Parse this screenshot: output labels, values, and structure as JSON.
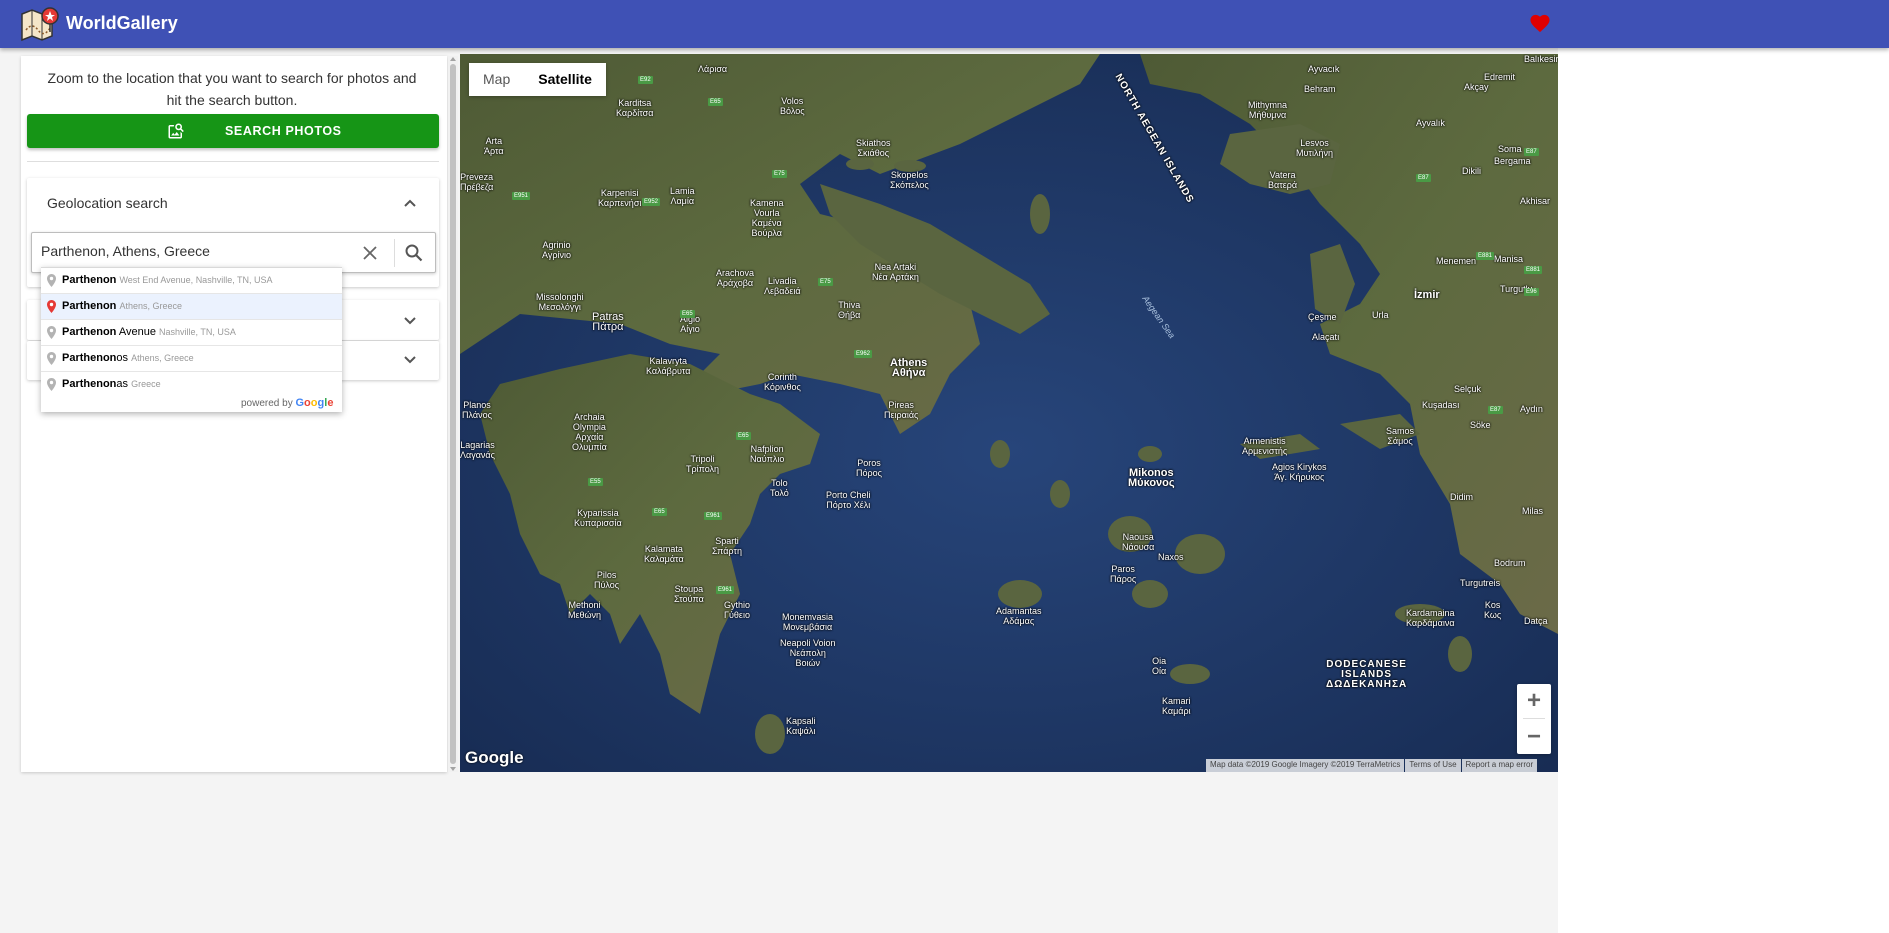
{
  "app": {
    "title": "WorldGallery",
    "logo_icon": "map-pin-logo-icon",
    "favorite_icon": "heart-icon",
    "accent_color": "#3f51b5",
    "favorite_color": "#e00000"
  },
  "panel": {
    "instructions": "Zoom to the location that you want to search for photos and hit the search button.",
    "search_button": {
      "label": "SEARCH PHOTOS",
      "icon": "image-search-icon",
      "color": "#169516"
    },
    "geolocation": {
      "title": "Geolocation search",
      "expanded": true,
      "input_value": "Parthenon, Athens, Greece",
      "clear_icon": "close-icon",
      "search_icon": "search-icon"
    },
    "collapsed_sections": [
      {
        "icon": "chevron-down-icon"
      },
      {
        "icon": "chevron-down-icon"
      }
    ]
  },
  "autocomplete": {
    "items": [
      {
        "match": "Parthenon",
        "rest": "",
        "secondary": "West End Avenue, Nashville, TN, USA",
        "selected": false
      },
      {
        "match": "Parthenon",
        "rest": "",
        "secondary": "Athens, Greece",
        "selected": true
      },
      {
        "match": "Parthenon",
        "rest": " Avenue",
        "secondary": "Nashville, TN, USA",
        "selected": false
      },
      {
        "match": "Parthenon",
        "rest": "os",
        "secondary": "Athens, Greece",
        "selected": false
      },
      {
        "match": "Parthenon",
        "rest": "as",
        "secondary": "Greece",
        "selected": false
      }
    ],
    "powered_by": "powered by",
    "powered_brand": "Google"
  },
  "map": {
    "map_type_options": [
      "Map",
      "Satellite"
    ],
    "active_map_type": "Satellite",
    "zoom_in": "+",
    "zoom_out": "−",
    "logo": "Google",
    "attribution": [
      "Map data ©2019 Google Imagery ©2019 TerraMetrics",
      "Terms of Use",
      "Report a map error"
    ],
    "labels": {
      "volos": "Volos\nΒόλος",
      "karditsa": "Karditsa\nΚαρδίτσα",
      "lamia": "Lamia\nΛαμία",
      "karpenisi": "Karpenisi\nΚαρπενήσι",
      "kamena_vourla": "Kamena\nVourla\nΚαμένα\nΒούρλα",
      "skiathos": "Skiathos\nΣκιάθος",
      "skopelos": "Skopelos\nΣκόπελος",
      "agrinio": "Agrinio\nΑγρίνιο",
      "missolonghi": "Missolonghi\nΜεσολόγγι",
      "arachova": "Arachova\nΑράχοβα",
      "livadia": "Livadia\nΛεβαδειά",
      "nea_artaki": "Nea Artaki\nΝέα Αρτάκη",
      "thiva": "Thiva\nΘήβα",
      "patras": "Patras\nΠάτρα",
      "aigio": "Aigio\nΑίγιο",
      "athens": "Athens\nΑθήνα",
      "pireas": "Pireas\nΠειραιάς",
      "corinth": "Corinth\nΚόρινθος",
      "kalavryta": "Kalavryta\nΚαλάβρυτα",
      "archaia_olympia": "Archaia\nOlympia\nΑρχαία\nΟλυμπία",
      "tripoli": "Tripoli\nΤρίπολη",
      "nafplion": "Nafplion\nΝαύπλιο",
      "poros": "Poros\nΠόρος",
      "tolo": "Tolo\nΤολό",
      "porto_cheli": "Porto Cheli\nΠόρτο Χέλι",
      "kyparissia": "Kyparissia\nΚυπαρισσία",
      "kalamata": "Kalamata\nΚαλαμάτα",
      "sparti": "Sparti\nΣπάρτη",
      "pilos": "Pilos\nΠύλος",
      "methoni": "Methoni\nΜεθώνη",
      "stoupa": "Stoupa\nΣτούπα",
      "gythio": "Gythio\nΓύθειο",
      "monemvasia": "Monemvasia\nΜονεμβάσια",
      "neapoli": "Neapoli Voion\nΝεάπολη\nΒοιών",
      "kapsali": "Kapsali\nΚαψάλι",
      "planos": "Planos\nΠλάνος",
      "lagarias": "Lagarias\nΛαγανάς",
      "mikonos": "Mikonos\nΜύκονος",
      "naousa": "Naousa\nΝάουσα",
      "naxos": "Naxos",
      "paros": "Paros\nΠάρος",
      "adamantas": "Adamantas\nΑδάμας",
      "oia": "Oia\nΟία",
      "kamari": "Kamari\nΚαμάρι",
      "armenistis": "Armenistis\nΑρμενιστής",
      "agios_kirykos": "Agios Kirykos\nΆγ. Κήρυκος",
      "samos": "Samos\nΣάμος",
      "lesvos": "Lesvos\nΜυτιλήνη",
      "mithymna": "Mithymna\nΜήθυμνα",
      "vatera": "Vatera\nΒατερά",
      "ayvacik": "Ayvacık",
      "behram": "Behram",
      "edremit": "Edremit",
      "akcay": "Akçay",
      "ayvalik": "Ayvalık",
      "bergama": "Bergama",
      "soma": "Soma",
      "dikili": "Dikili",
      "akhisar": "Akhisar",
      "menemen": "Menemen",
      "manisa": "Manisa",
      "izmir": "İzmir",
      "turgutlu": "Turgutlu",
      "cesme": "Çeşme",
      "urla": "Urla",
      "alacati": "Alaçatı",
      "selcuk": "Selçuk",
      "kusadasi": "Kuşadası",
      "aydin": "Aydın",
      "soke": "Söke",
      "didim": "Didim",
      "milas": "Milas",
      "bodrum": "Bodrum",
      "turgutreis": "Turgutreis",
      "kardamaina": "Kardamaina\nΚαρδάμαινα",
      "kos": "Kos\nΚως",
      "datca": "Datça",
      "planos_top": "Planos",
      "amfissa": "Arta\nΆρτα",
      "preveza": "Preveza\nΠρέβεζα",
      "larisa": "Λάρισα",
      "aegean_sea": "Aegean Sea",
      "dodecanese": "DODECANESE\nISLANDS\nΔΩΔΕΚΑΝΗΣΑ",
      "north_aegean": "NORTH AEGEAN ISLANDS",
      "balikesir": "Balıkesir"
    },
    "roads": [
      "E92",
      "E65",
      "E75",
      "E951",
      "E952",
      "E75",
      "E65",
      "E962",
      "E65",
      "E55",
      "E65",
      "E961",
      "E961",
      "E87",
      "E87",
      "E881",
      "E881",
      "E96",
      "E87"
    ]
  }
}
